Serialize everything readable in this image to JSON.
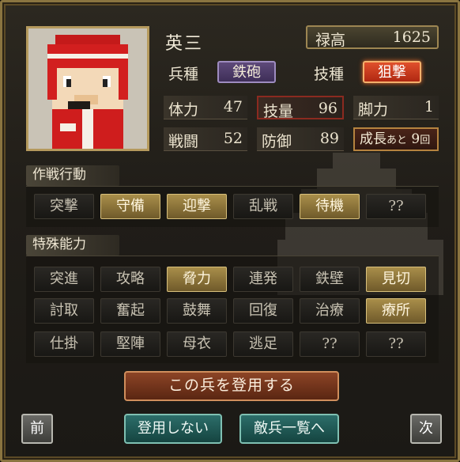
{
  "unit": {
    "name": "英三",
    "stipend_label": "禄高",
    "stipend_value": "1625",
    "troop_type_label": "兵種",
    "troop_type_value": "鉄砲",
    "skill_type_label": "技種",
    "skill_type_value": "狙撃"
  },
  "stats": {
    "stamina": {
      "label": "体力",
      "value": "47"
    },
    "skill": {
      "label": "技量",
      "value": "96"
    },
    "legs": {
      "label": "脚力",
      "value": "1"
    },
    "combat": {
      "label": "戦闘",
      "value": "52"
    },
    "defense": {
      "label": "防御",
      "value": "89"
    },
    "growth": {
      "label": "成長",
      "remain": "あと",
      "value": "9",
      "unit": "回"
    }
  },
  "tactics": {
    "title": "作戦行動",
    "items": [
      {
        "label": "突撃",
        "state": "off"
      },
      {
        "label": "守備",
        "state": "on"
      },
      {
        "label": "迎撃",
        "state": "on"
      },
      {
        "label": "乱戦",
        "state": "off"
      },
      {
        "label": "待機",
        "state": "on"
      },
      {
        "label": "??",
        "state": "off"
      }
    ]
  },
  "abilities": {
    "title": "特殊能力",
    "rows": [
      [
        {
          "label": "突進",
          "state": "off"
        },
        {
          "label": "攻略",
          "state": "off"
        },
        {
          "label": "脅力",
          "state": "on"
        },
        {
          "label": "連発",
          "state": "off"
        },
        {
          "label": "鉄壁",
          "state": "off"
        },
        {
          "label": "見切",
          "state": "on"
        }
      ],
      [
        {
          "label": "討取",
          "state": "off"
        },
        {
          "label": "奮起",
          "state": "off"
        },
        {
          "label": "鼓舞",
          "state": "off"
        },
        {
          "label": "回復",
          "state": "off"
        },
        {
          "label": "治療",
          "state": "off"
        },
        {
          "label": "療所",
          "state": "on"
        }
      ],
      [
        {
          "label": "仕掛",
          "state": "off"
        },
        {
          "label": "堅陣",
          "state": "off"
        },
        {
          "label": "母衣",
          "state": "off"
        },
        {
          "label": "逃足",
          "state": "off"
        },
        {
          "label": "??",
          "state": "off"
        },
        {
          "label": "??",
          "state": "off"
        }
      ]
    ]
  },
  "actions": {
    "recruit": "この兵を登用する",
    "decline": "登用しない",
    "enemy_list": "敵兵一覧へ",
    "prev": "前",
    "next": "次"
  },
  "colors": {
    "frame": "#8a7440",
    "active_button": "#a98e4a",
    "highlight": "#e0502c",
    "recruit_button": "#8c4426",
    "sub_button": "#2c6e6a"
  }
}
